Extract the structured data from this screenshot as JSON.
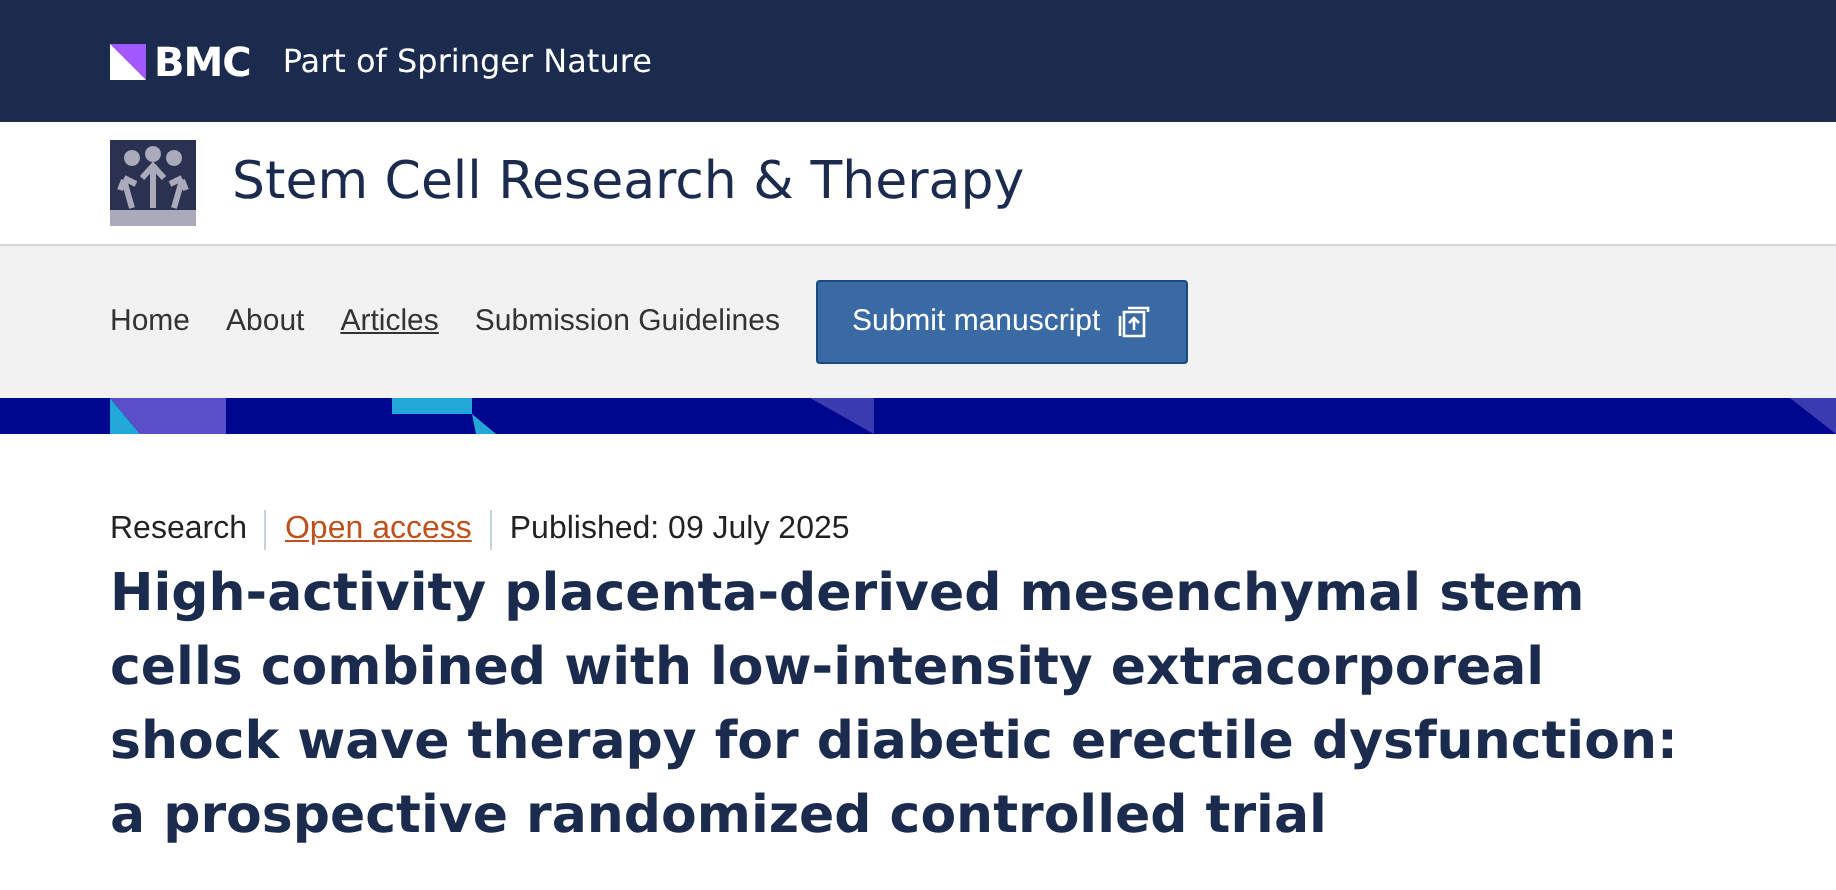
{
  "top_bar": {
    "brand": "BMC",
    "tagline": "Part of Springer Nature"
  },
  "journal": {
    "title": "Stem Cell Research & Therapy"
  },
  "nav": {
    "items": [
      {
        "label": "Home",
        "selected": false
      },
      {
        "label": "About",
        "selected": false
      },
      {
        "label": "Articles",
        "selected": true
      },
      {
        "label": "Submission Guidelines",
        "selected": false
      }
    ],
    "submit_button": "Submit manuscript"
  },
  "article": {
    "meta": [
      {
        "kind": "text",
        "label": "Research"
      },
      {
        "kind": "link",
        "label": "Open access"
      },
      {
        "kind": "text",
        "label": "Published: 09 July 2025"
      }
    ],
    "title": "High-activity placenta-derived mesenchymal stem cells combined with low-intensity extracorporeal shock wave therapy for diabetic erectile dysfunction: a prospective randomized controlled trial"
  }
}
